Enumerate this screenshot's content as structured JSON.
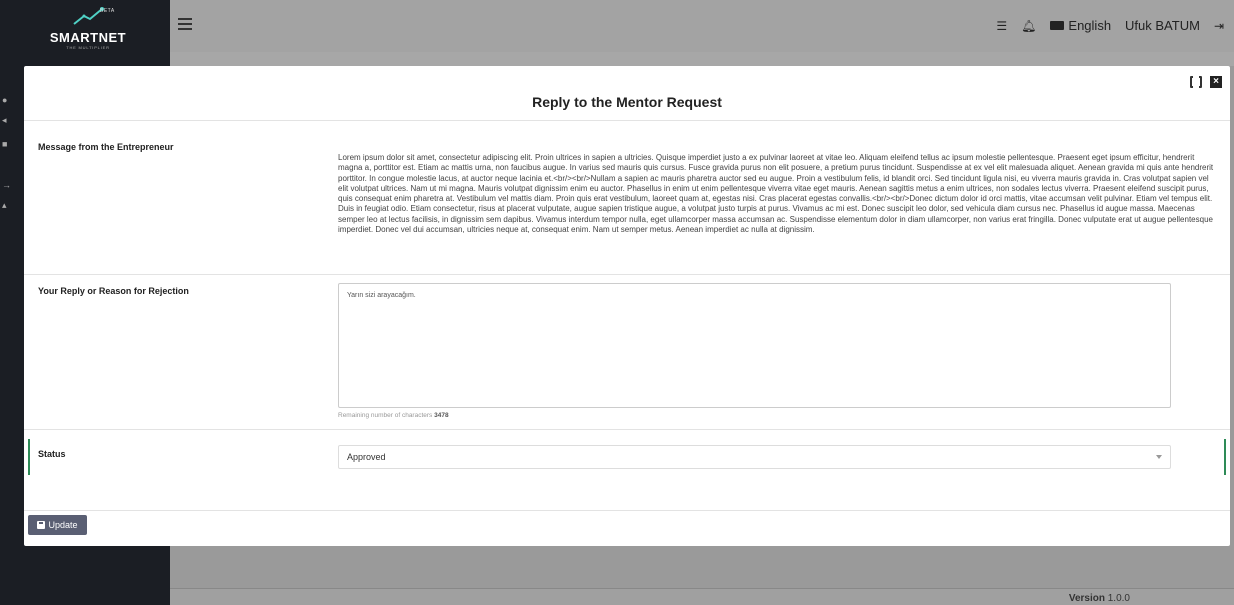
{
  "app": {
    "logo_badge": "BETA",
    "logo_title": "SMARTNET",
    "logo_subtitle": "THE MULTIPLIER"
  },
  "header": {
    "language": "English",
    "user_name": "Ufuk BATUM",
    "icons": [
      "menu-icon",
      "checklist-icon",
      "bell-icon",
      "language-flag-icon",
      "logout-icon"
    ]
  },
  "modal": {
    "title": "Reply to the Mentor Request",
    "message_label": "Message from the Entrepreneur",
    "message_text": "Lorem ipsum dolor sit amet, consectetur adipiscing elit. Proin ultrices in sapien a ultricies. Quisque imperdiet justo a ex pulvinar laoreet at vitae leo. Aliquam eleifend tellus ac ipsum molestie pellentesque. Praesent eget ipsum efficitur, hendrerit magna a, porttitor est. Etiam ac mattis urna, non faucibus augue. In varius sed mauris quis cursus. Fusce gravida purus non elit posuere, a pretium purus tincidunt. Suspendisse at ex vel elit malesuada aliquet. Aenean gravida mi quis ante hendrerit porttitor. In congue molestie lacus, at auctor neque lacinia et.<br/><br/>Nullam a sapien ac mauris pharetra auctor sed eu augue. Proin a vestibulum felis, id blandit orci. Sed tincidunt ligula nisi, eu viverra mauris gravida in. Cras volutpat sapien vel elit volutpat ultrices. Nam ut mi magna. Mauris volutpat dignissim enim eu auctor. Phasellus in enim ut enim pellentesque viverra vitae eget mauris. Aenean sagittis metus a enim ultrices, non sodales lectus viverra. Praesent eleifend suscipit purus, quis consequat enim pharetra at. Vestibulum vel mattis diam. Proin quis erat vestibulum, laoreet quam at, egestas nisi. Cras placerat egestas convallis.<br/><br/>Donec dictum dolor id orci mattis, vitae accumsan velit pulvinar. Etiam vel tempus elit. Duis in feugiat odio. Etiam consectetur, risus at placerat vulputate, augue sapien tristique augue, a volutpat justo turpis at purus. Vivamus ac mi est. Donec suscipit leo dolor, sed vehicula diam cursus nec. Phasellus id augue massa. Maecenas semper leo at lectus facilisis, in dignissim sem dapibus. Vivamus interdum tempor nulla, eget ullamcorper massa accumsan ac. Suspendisse elementum dolor in diam ullamcorper, non varius erat fringilla. Donec vulputate erat ut augue pellentesque imperdiet. Donec vel dui accumsan, ultricies neque at, consequat enim. Nam ut semper metus. Aenean imperdiet ac nulla at dignissim.",
    "reply_label": "Your Reply or Reason for Rejection",
    "reply_value": "Yarın sizi arayacağım.",
    "remaining_label": "Remaining number of characters",
    "remaining_count": "3478",
    "status_label": "Status",
    "status_value": "Approved",
    "update_label": "Update"
  },
  "footer": {
    "version_label": "Version",
    "version_number": "1.0.0"
  },
  "colors": {
    "sidebar": "#1b1e24",
    "status_accent": "#2e8b57",
    "update_button": "#5a5f73"
  }
}
